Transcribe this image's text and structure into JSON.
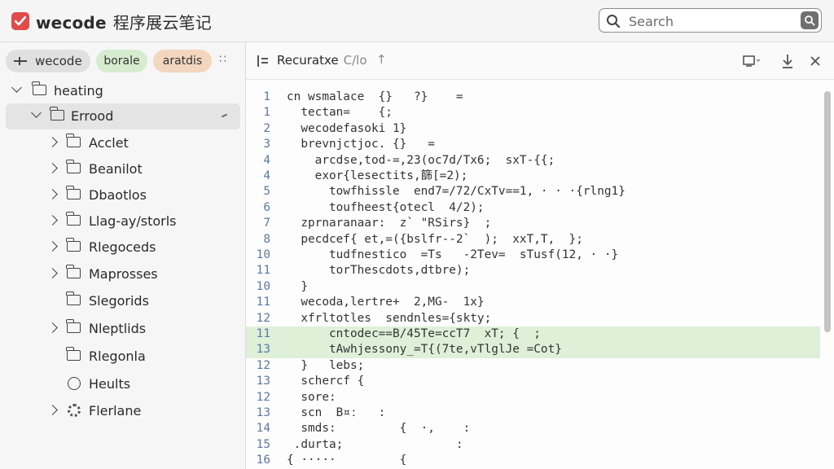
{
  "app": {
    "title": "wecode",
    "title_cn": "程序展云笔记"
  },
  "search": {
    "placeholder": "Search"
  },
  "chips": [
    {
      "label": "wecode"
    },
    {
      "label": "borale"
    },
    {
      "label": "aratdis"
    }
  ],
  "tree": [
    {
      "label": "heating",
      "indent": 0,
      "expanded": true
    },
    {
      "label": "Errood",
      "indent": 1,
      "expanded": true,
      "selected": true
    },
    {
      "label": "Acclet",
      "indent": 2
    },
    {
      "label": "Beanilot",
      "indent": 2
    },
    {
      "label": "Dbaotlos",
      "indent": 2
    },
    {
      "label": "Llag-ay/storls",
      "indent": 2
    },
    {
      "label": "Rlegoceds",
      "indent": 2
    },
    {
      "label": "Maprosses",
      "indent": 2
    },
    {
      "label": "Slegorids",
      "indent": 2
    },
    {
      "label": "Nleptlids",
      "indent": 2
    },
    {
      "label": "Rlegonla",
      "indent": 2
    },
    {
      "label": "Heults",
      "indent": 2
    },
    {
      "label": "Flerlane",
      "indent": 2
    }
  ],
  "editor": {
    "tab_title": "Recuratxe",
    "tab_sub": "C/lo",
    "lines": [
      {
        "n": "1",
        "t": "cn wsmalace  {}   ?}    ="
      },
      {
        "n": "1",
        "t": "  tectan=    {;"
      },
      {
        "n": "2",
        "t": "  wecodefasoki 1}"
      },
      {
        "n": "3",
        "t": "  brevnjctjoc. {}   ="
      },
      {
        "n": "4",
        "t": "    arcdse,tod-=,23(oc7d/Tx6;  sxT-{{;"
      },
      {
        "n": "4",
        "t": "    exor{lesectits,篩[=2);"
      },
      {
        "n": "5",
        "t": "      towfhissle  end7=/72/CxTv==1, · · ·{rlng1}"
      },
      {
        "n": "6",
        "t": "      toufheest{otecl  4/2);"
      },
      {
        "n": "7",
        "t": "  zprnaranaar:  z` \"RSirs}  ;"
      },
      {
        "n": "8",
        "t": "  pecdcef{ et,=({bslfr--2`  );  xxT,T,  };"
      },
      {
        "n": "10",
        "t": "      tudfnestico  =Ts   -2Tev=  sTusf(12, · ·}"
      },
      {
        "n": "11",
        "t": "      torThescdots,dtbre);"
      },
      {
        "n": "10",
        "t": "  }"
      },
      {
        "n": "11",
        "t": "  wecoda,lertre+  2,MG-  1x}"
      },
      {
        "n": "12",
        "t": "  xfrltotles  sendnles={skty;"
      },
      {
        "n": "11",
        "t": "      cntodec==B/45Te=ccT7  xT; {  ;",
        "hl": true
      },
      {
        "n": "13",
        "t": "      tAwhjessony_=T{(7te,vTlglJe =Cot}",
        "hl": true
      },
      {
        "n": "12",
        "t": "  }   lebs;"
      },
      {
        "n": "13",
        "t": "  schercf {"
      },
      {
        "n": "12",
        "t": "  sore:"
      },
      {
        "n": "13",
        "t": "  scn  B¤ː   :"
      },
      {
        "n": "14",
        "t": "  smds:         {  ·,    :"
      },
      {
        "n": "15",
        "t": " .durta;                :"
      },
      {
        "n": "16",
        "t": "{ ·····         {"
      }
    ]
  }
}
